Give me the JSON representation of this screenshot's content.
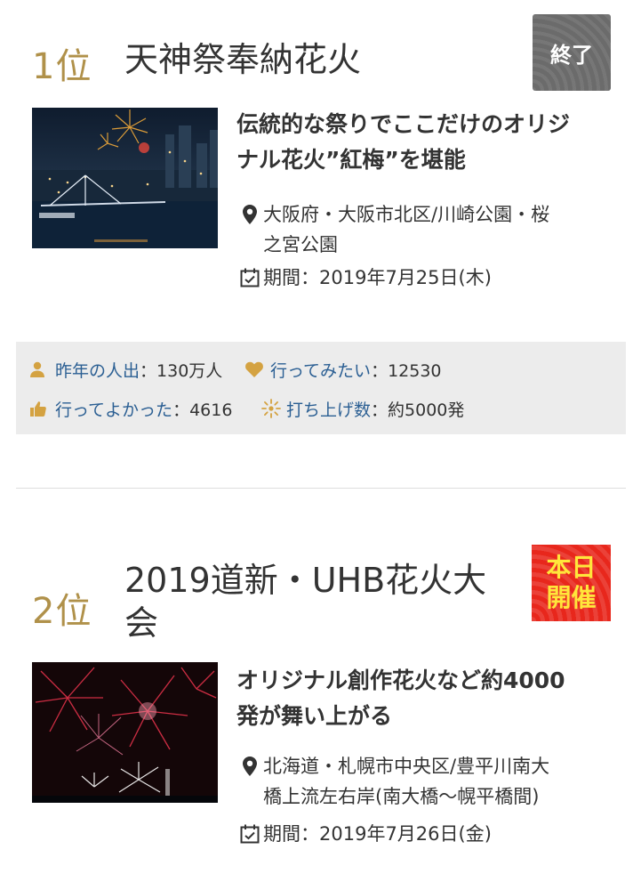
{
  "items": [
    {
      "rank": "1位",
      "title": "天神祭奉納花火",
      "badge": "終了",
      "lead": [
        "伝統的な祭りでここだけのオリジ",
        "ナル花火”紅梅”を堪能"
      ],
      "location": [
        "大阪府・大阪市北区/川崎公園・桜",
        "之宮公園"
      ],
      "period": "期間：2019年7月25日(木)",
      "stats": {
        "visitors_label": "昨年の人出",
        "visitors_value": "：130万人",
        "want_label": "行ってみたい",
        "want_value": "：12530",
        "good_label": "行ってよかった",
        "good_value": "：4616",
        "shots_label": "打ち上げ数",
        "shots_value": "：約5000発"
      }
    },
    {
      "rank": "2位",
      "title": [
        "2019道新・UHB花火大",
        "会"
      ],
      "badge": [
        "本日",
        "開催"
      ],
      "lead": [
        "オリジナル創作花火など約4000",
        "発が舞い上がる"
      ],
      "location": [
        "北海道・札幌市中央区/豊平川南大",
        "橋上流左右岸(南大橋〜幌平橋間)"
      ],
      "period": "期間：2019年7月26日(金)"
    }
  ],
  "icons": {
    "location": "map-pin-icon",
    "calendar": "calendar-check-icon",
    "person": "person-icon",
    "heart": "heart-icon",
    "thumb": "thumbs-up-icon",
    "firework": "firework-icon"
  },
  "colors": {
    "rank": "#b0914a",
    "stat_label": "#2b5f93",
    "stat_icon": "#d4a241",
    "badge_ended": "#6b6b6b",
    "badge_today": "#e8271c",
    "badge_today_text": "#ffe63b"
  }
}
